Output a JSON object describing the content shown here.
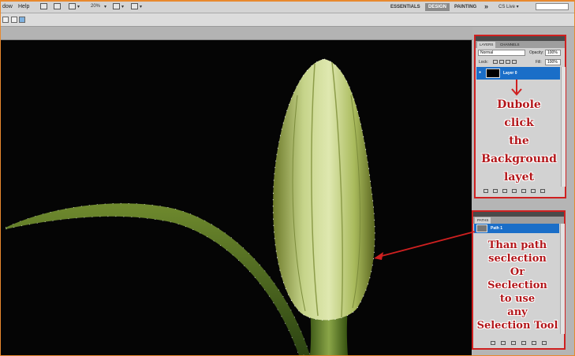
{
  "menubar": {
    "window_partial": "dow",
    "help": "Help",
    "zoom": "20%"
  },
  "workspaces": {
    "essentials": "ESSENTIALS",
    "design": "DESIGN",
    "painting": "PAINTING",
    "more": "»",
    "cslive": "CS Live ▾"
  },
  "layers_panel": {
    "tab_layers": "LAYERS",
    "tab_channels": "CHANNELS",
    "blend_mode": "Normal",
    "opacity_label": "Opacity:",
    "opacity_value": "100%",
    "lock_label": "Lock:",
    "fill_label": "Fill:",
    "fill_value": "100%",
    "layer_name": "Layer 0",
    "annotation_lines": [
      "Dubole",
      "click",
      "the",
      "Background",
      "layet"
    ]
  },
  "paths_panel": {
    "tab_paths": "PATHS",
    "path_name": "Path 1",
    "annotation_lines": [
      "Than path",
      "seclection",
      "Or",
      "Seclection",
      "to use",
      "any",
      "Selection Tool"
    ]
  },
  "colors": {
    "accent_red": "#cf2020",
    "selection_blue": "#1a6ec8",
    "frame_orange": "#e8892e"
  }
}
